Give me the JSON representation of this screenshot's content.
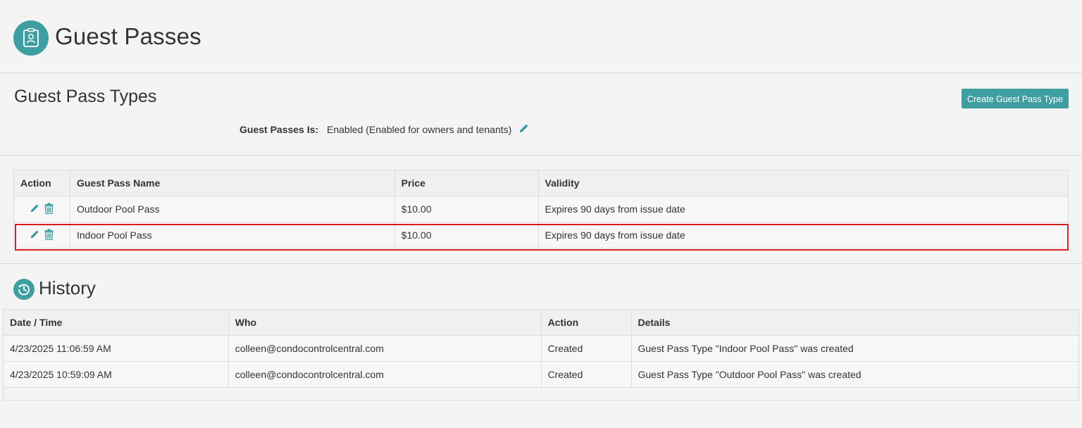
{
  "header": {
    "title": "Guest Passes",
    "icon": "id-badge-icon"
  },
  "types_section": {
    "title": "Guest Pass Types",
    "create_button_label": "Create Guest Pass Type",
    "status_label": "Guest Passes Is:",
    "status_value": "Enabled (Enabled for owners and tenants)"
  },
  "types_table": {
    "columns": [
      "Action",
      "Guest Pass Name",
      "Price",
      "Validity"
    ],
    "rows": [
      {
        "name": "Outdoor Pool Pass",
        "price": "$10.00",
        "validity": "Expires 90 days from issue date"
      },
      {
        "name": "Indoor Pool Pass",
        "price": "$10.00",
        "validity": "Expires 90 days from issue date",
        "highlighted": true
      }
    ]
  },
  "history": {
    "title": "History",
    "icon": "history-clock-icon",
    "columns": [
      "Date / Time",
      "Who",
      "Action",
      "Details"
    ],
    "rows": [
      {
        "datetime": "4/23/2025 11:06:59 AM",
        "who": "colleen@condocontrolcentral.com",
        "action": "Created",
        "details": "Guest Pass Type \"Indoor Pool Pass\" was created"
      },
      {
        "datetime": "4/23/2025 10:59:09 AM",
        "who": "colleen@condocontrolcentral.com",
        "action": "Created",
        "details": "Guest Pass Type \"Outdoor Pool Pass\" was created"
      }
    ]
  },
  "colors": {
    "accent": "#3f9ea1",
    "highlight": "#dd1c1c"
  }
}
